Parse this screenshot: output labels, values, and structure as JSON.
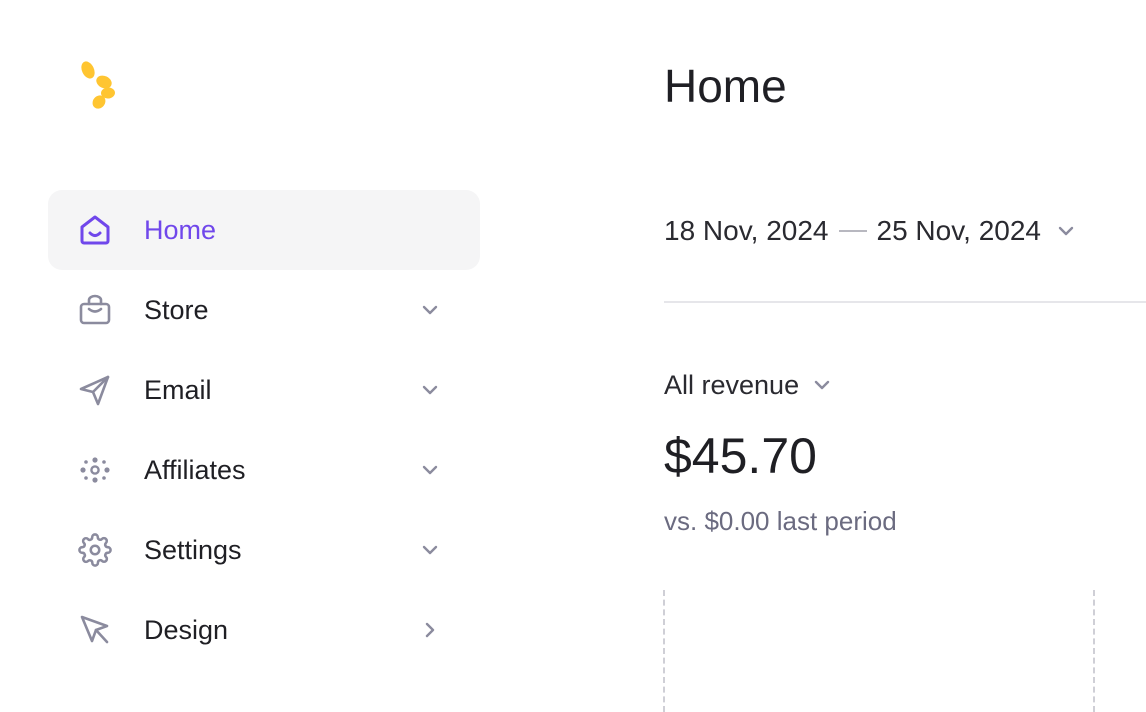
{
  "brand": {
    "logo_icon": "petal-logo-icon",
    "logo_color": "#ffc531"
  },
  "colors": {
    "accent": "#7047eb",
    "icon_gray": "#8b8b9e",
    "text": "#1f1f24",
    "muted": "#6b6b80"
  },
  "sidebar": {
    "items": [
      {
        "label": "Home",
        "icon": "home-icon",
        "active": true,
        "chevron": "none"
      },
      {
        "label": "Store",
        "icon": "shopping-bag-icon",
        "active": false,
        "chevron": "down"
      },
      {
        "label": "Email",
        "icon": "send-icon",
        "active": false,
        "chevron": "down"
      },
      {
        "label": "Affiliates",
        "icon": "dots-network-icon",
        "active": false,
        "chevron": "down"
      },
      {
        "label": "Settings",
        "icon": "gear-icon",
        "active": false,
        "chevron": "down"
      },
      {
        "label": "Design",
        "icon": "cursor-icon",
        "active": false,
        "chevron": "right"
      }
    ]
  },
  "main": {
    "title": "Home",
    "date_range": {
      "start": "18 Nov, 2024",
      "end": "25 Nov, 2024"
    },
    "metric": {
      "selector_label": "All revenue",
      "value": "$45.70",
      "comparison": "vs. $0.00 last period"
    }
  }
}
